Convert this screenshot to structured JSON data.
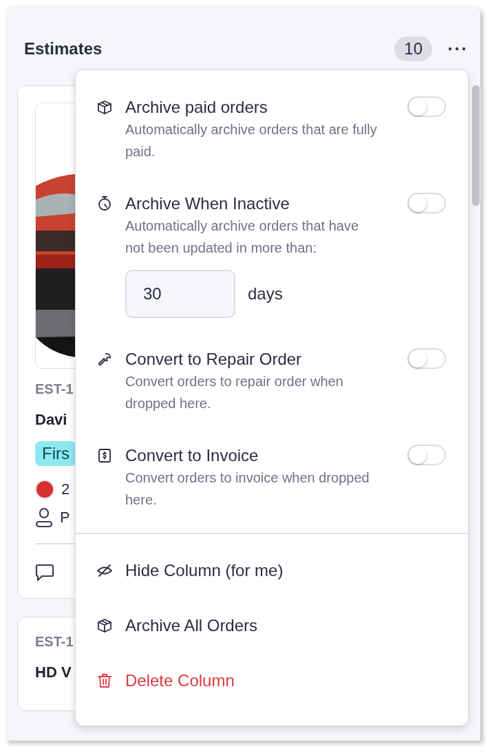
{
  "column": {
    "title": "Estimates",
    "count": "10"
  },
  "cards": [
    {
      "number": "EST-1",
      "name": "Davi",
      "tag": "Firs",
      "date": "2",
      "person": "P",
      "picture": true
    },
    {
      "number": "EST-1",
      "name": "HD V"
    }
  ],
  "menu": {
    "settings": [
      {
        "kind": "archive",
        "title": "Archive paid orders",
        "description": "Automatically archive orders that are fully paid.",
        "on": false
      },
      {
        "kind": "timer",
        "title": "Archive When Inactive",
        "description": "Automatically archive orders that have not been updated in more than:",
        "on": false,
        "field": {
          "value": "30",
          "unit": "days"
        }
      },
      {
        "kind": "wrench",
        "title": "Convert to Repair Order",
        "description": "Convert orders to repair order when dropped here.",
        "on": false
      },
      {
        "kind": "invoice",
        "title": "Convert to Invoice",
        "description": "Convert orders to invoice when dropped here.",
        "on": false
      }
    ],
    "actions": [
      {
        "kind": "hide",
        "label": "Hide Column (for me)",
        "danger": false
      },
      {
        "kind": "archive",
        "label": "Archive All Orders",
        "danger": false
      },
      {
        "kind": "delete",
        "label": "Delete Column",
        "danger": true
      }
    ]
  }
}
